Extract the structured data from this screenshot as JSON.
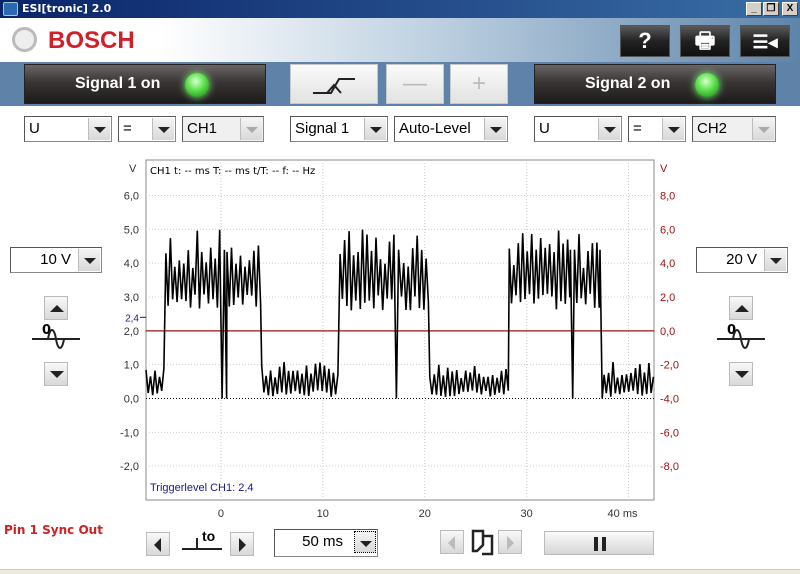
{
  "window": {
    "title": "ESI[tronic] 2.0",
    "controls": [
      "_",
      "❐",
      "X"
    ]
  },
  "header": {
    "brand": "BOSCH",
    "help_label": "?"
  },
  "signal1": {
    "label": "Signal 1 on",
    "measure": "U",
    "coupling": "=",
    "channel": "CH1",
    "scale": "10 V"
  },
  "signal2": {
    "label": "Signal 2 on",
    "measure": "U",
    "coupling": "=",
    "channel": "CH2",
    "scale": "20 V"
  },
  "trigger": {
    "source": "Signal 1",
    "mode": "Auto-Level",
    "minus": "—",
    "plus": "+"
  },
  "bottom": {
    "pin_label": "Pin 1 Sync Out",
    "timebase": "50 ms",
    "t0_label": "to"
  },
  "colors": {
    "ch1": "#000000",
    "ch2": "#a01010",
    "trigger": "#1a1a80",
    "brand": "#d0202a"
  },
  "chart_data": {
    "type": "line",
    "info": "CH1  t: -- ms   T: -- ms   t/T: --   f: -- Hz",
    "trigger_text": "Triggerlevel CH1: 2,4",
    "trigger_level": 2.4,
    "trigger_label": "2,4",
    "left_axis": {
      "unit": "V",
      "range": [
        -3.0,
        7.05
      ],
      "ticks": [
        6,
        5,
        4,
        3,
        2,
        1,
        0,
        -1,
        -2
      ],
      "tick_labels": [
        "6,0",
        "5,0",
        "4,0",
        "3,0",
        "2,0",
        "1,0",
        "0,0",
        "-1,0",
        "-2,0"
      ]
    },
    "right_axis": {
      "unit": "V",
      "ticks": [
        8,
        6,
        4,
        2,
        0,
        -2,
        -4,
        -6,
        -8
      ],
      "tick_labels": [
        "8,0",
        "6,0",
        "4,0",
        "2,0",
        "0,0",
        "-2,0",
        "-4,0",
        "-6,0",
        "-8,0"
      ]
    },
    "x_axis": {
      "range": [
        -7.35,
        42.5
      ],
      "ticks": [
        0,
        10,
        20,
        30,
        40
      ],
      "tick_labels": [
        "0",
        "10",
        "20",
        "30",
        "40 ms"
      ]
    },
    "series": [
      {
        "name": "CH1",
        "segments": [
          [
            -7.35,
            -5.4,
            "low"
          ],
          [
            -5.4,
            -0.1,
            "high"
          ],
          [
            -0.1,
            0.6,
            "drop"
          ],
          [
            0.6,
            4.0,
            "high"
          ],
          [
            4.0,
            11.7,
            "low"
          ],
          [
            11.7,
            17.0,
            "high"
          ],
          [
            17.0,
            17.5,
            "drop"
          ],
          [
            17.5,
            20.5,
            "high"
          ],
          [
            20.5,
            28.3,
            "low"
          ],
          [
            28.3,
            34.3,
            "high"
          ],
          [
            34.3,
            34.7,
            "drop"
          ],
          [
            34.7,
            37.2,
            "high"
          ],
          [
            37.2,
            37.6,
            "drop"
          ],
          [
            37.6,
            42.5,
            "low"
          ]
        ]
      },
      {
        "name": "CH2",
        "value_left_units": 2.0
      }
    ]
  }
}
